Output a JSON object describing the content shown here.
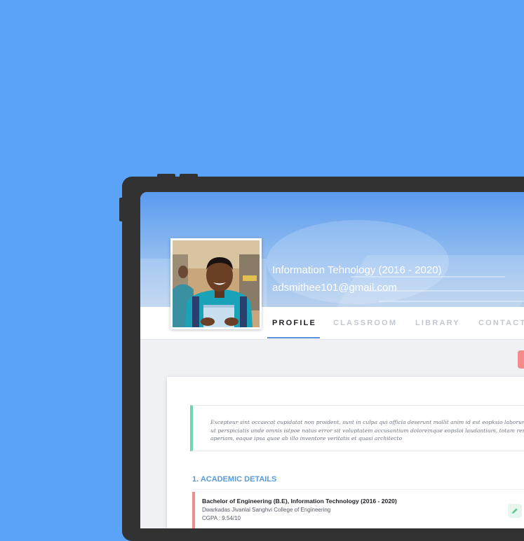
{
  "profile": {
    "line1": "Information Tehnology (2016 - 2020)",
    "line2": "adsmithee101@gmail.com"
  },
  "tabs": [
    {
      "label": "PROFILE",
      "active": true
    },
    {
      "label": "CLASSROOM",
      "active": false
    },
    {
      "label": "LIBRARY",
      "active": false
    },
    {
      "label": "CONTACT",
      "active": false
    }
  ],
  "about": {
    "text": "Excepteur sint occaecat cupidatat non proident, sunt in culpa qui officia deserunt mollit anim id est eopksio laborum\nut perspiciatis unde omnis istpoe natus error sit voluptatem accusantium doloremque eopsloi laudantium, totam rem\naperiam, eaque ipsa quae ab illo inventore veritatis et quasi architecto"
  },
  "academic": {
    "section_title": "1. ACADEMIC DETAILS",
    "entries": [
      {
        "title": "Bachelor of Engineering (B.E), Information Technology (2016 - 2020)",
        "institution": "Dwarkadas Jivanlal Sanghvi College of Engineering",
        "cgpa": "CGPA : 9.54/10"
      }
    ]
  },
  "icons": {
    "edit": "pencil-icon",
    "action": "red-action-button"
  },
  "colors": {
    "background": "#5ba3f8",
    "accent": "#5a9ad6",
    "quote_border": "#6fd7b0",
    "entry_border": "#f28b8b"
  }
}
